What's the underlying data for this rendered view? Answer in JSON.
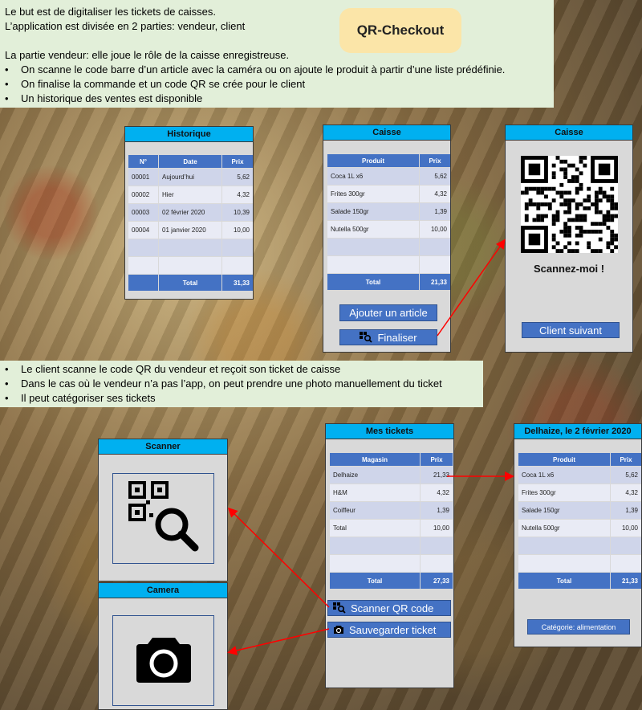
{
  "intro": {
    "line1": "Le but est de digitaliser les tickets de caisses.",
    "line2": "L’application est divisée en 2 parties: vendeur, client",
    "line3": "La partie vendeur: elle joue le rôle de la caisse enregistreuse.",
    "bullets": [
      "On scanne le code barre d’un article avec la caméra ou on ajoute le produit à partir d’une liste prédéfinie.",
      "On finalise la commande et un code QR se crée pour le client",
      "Un historique des ventes est disponible"
    ]
  },
  "brand": "QR-Checkout",
  "historique": {
    "title": "Historique",
    "headers": [
      "N°",
      "Date",
      "Prix"
    ],
    "rows": [
      {
        "n": "00001",
        "date": "Aujourd’hui",
        "prix": "5,62"
      },
      {
        "n": "00002",
        "date": "Hier",
        "prix": "4,32"
      },
      {
        "n": "00003",
        "date": "02 février 2020",
        "prix": "10,39"
      },
      {
        "n": "00004",
        "date": "01 janvier 2020",
        "prix": "10,00"
      }
    ],
    "total_label": "Total",
    "total": "31,33"
  },
  "caisse": {
    "title": "Caisse",
    "headers": [
      "Produit",
      "Prix"
    ],
    "rows": [
      {
        "produit": "Coca 1L x6",
        "prix": "5,62"
      },
      {
        "produit": "Frites 300gr",
        "prix": "4,32"
      },
      {
        "produit": "Salade 150gr",
        "prix": "1,39"
      },
      {
        "produit": "Nutella 500gr",
        "prix": "10,00"
      }
    ],
    "total_label": "Total",
    "total": "21,33",
    "add_button": "Ajouter un article",
    "finalize_button": "Finaliser"
  },
  "caisse_qr": {
    "title": "Caisse",
    "scan_text": "Scannez-moi !",
    "next_button": "Client suivant"
  },
  "client_intro": {
    "bullets": [
      "Le client scanne le code QR du vendeur et reçoit son ticket de caisse",
      "Dans le cas où le vendeur n’a pas l’app, on peut prendre une photo manuellement du ticket",
      "Il peut catégoriser ses tickets"
    ]
  },
  "scanner": {
    "title": "Scanner"
  },
  "camera": {
    "title": "Camera"
  },
  "mes_tickets": {
    "title": "Mes tickets",
    "headers": [
      "Magasin",
      "Prix"
    ],
    "rows": [
      {
        "magasin": "Delhaize",
        "prix": "21,33"
      },
      {
        "magasin": "H&M",
        "prix": "4,32"
      },
      {
        "magasin": "Coiffeur",
        "prix": "1,39"
      },
      {
        "magasin": "Total",
        "prix": "10,00"
      }
    ],
    "total_label": "Total",
    "total": "27,33",
    "scan_button": "Scanner QR code",
    "save_button": "Sauvegarder ticket"
  },
  "ticket_detail": {
    "title": "Delhaize, le 2 février 2020",
    "headers": [
      "Produit",
      "Prix"
    ],
    "rows": [
      {
        "produit": "Coca 1L x6",
        "prix": "5,62"
      },
      {
        "produit": "Frites 300gr",
        "prix": "4,32"
      },
      {
        "produit": "Salade 150gr",
        "prix": "1,39"
      },
      {
        "produit": "Nutella 500gr",
        "prix": "10,00"
      }
    ],
    "total_label": "Total",
    "total": "21,33",
    "category": "Catégorie: alimentation"
  },
  "colors": {
    "header_blue": "#00b0f0",
    "table_blue": "#4472c4",
    "arrow_red": "#ff0000",
    "note_green": "#e2efd9",
    "brand_yellow": "#fbe5a8"
  }
}
